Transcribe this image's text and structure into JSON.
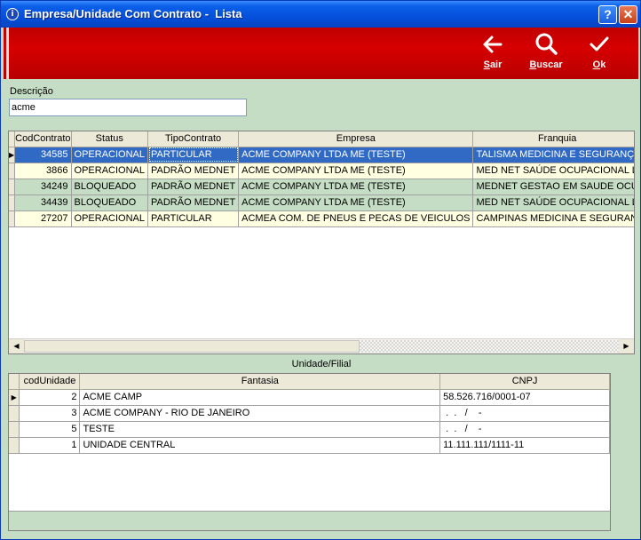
{
  "window": {
    "title": "Empresa/Unidade Com Contrato -  Lista",
    "help_label": "?",
    "close_label": "✕"
  },
  "toolbar": {
    "sair": {
      "prefix": "S",
      "rest": "air",
      "icon": "arrow-left-icon"
    },
    "buscar": {
      "prefix": "B",
      "rest": "uscar",
      "icon": "search-icon"
    },
    "ok": {
      "prefix": "O",
      "rest": "k",
      "icon": "checkmark-icon"
    }
  },
  "filter": {
    "label": "Descrição",
    "value": "acme"
  },
  "contracts": {
    "columns": [
      "CodContrato",
      "Status",
      "TipoContrato",
      "Empresa",
      "Franquia"
    ],
    "rows": [
      [
        "34585",
        "OPERACIONAL",
        "PARTICULAR",
        "ACME COMPANY LTDA ME (TESTE)",
        "TALISMA MEDICINA E SEGURANÇ"
      ],
      [
        "3866",
        "OPERACIONAL",
        "PADRÃO MEDNET",
        "ACME COMPANY LTDA ME (TESTE)",
        "MED NET SAÚDE OCUPACIONAL L"
      ],
      [
        "34249",
        "BLOQUEADO",
        "PADRÃO MEDNET",
        "ACME COMPANY LTDA ME (TESTE)",
        "MEDNET GESTAO EM SAUDE OCU"
      ],
      [
        "34439",
        "BLOQUEADO",
        "PADRÃO MEDNET",
        "ACME COMPANY LTDA ME (TESTE)",
        "MED NET SAÚDE OCUPACIONAL L"
      ],
      [
        "27207",
        "OPERACIONAL",
        "PARTICULAR",
        "ACMEA COM. DE PNEUS E PECAS DE VEICULOS",
        "CAMPINAS MEDICINA E SEGURAN"
      ]
    ]
  },
  "units": {
    "section_label": "Unidade/Filial",
    "columns": [
      "codUnidade",
      "Fantasia",
      "CNPJ"
    ],
    "rows": [
      [
        "2",
        "ACME CAMP",
        "58.526.716/0001-07"
      ],
      [
        "3",
        "ACME COMPANY - RIO DE JANEIRO",
        " .  .   /    -"
      ],
      [
        "5",
        "TESTE",
        " .  .   /    -"
      ],
      [
        "1",
        "UNIDADE CENTRAL",
        "11.111.111/1111-11"
      ]
    ]
  },
  "colors": {
    "toolbar_red": "#c00000",
    "form_green": "#c5ddc5",
    "selection_blue": "#316ac5",
    "row_yellow": "#ffffe1"
  }
}
